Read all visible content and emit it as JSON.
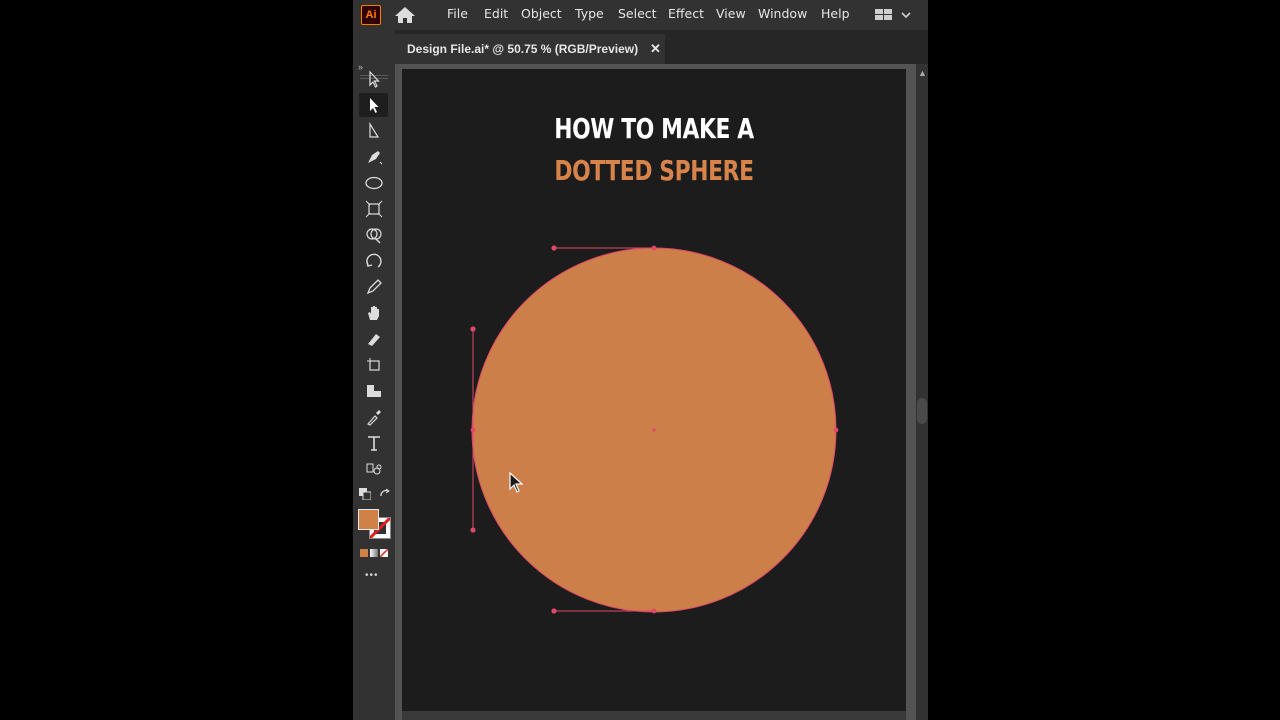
{
  "app": {
    "logo_text": "Ai",
    "menu": [
      "File",
      "Edit",
      "Object",
      "Type",
      "Select",
      "Effect",
      "View",
      "Window",
      "Help"
    ]
  },
  "document": {
    "tab_label": "Design File.ai* @ 50.75 % (RGB/Preview)",
    "close_glyph": "✕"
  },
  "artboard": {
    "title_line1": "HOW TO MAKE A",
    "title_line2": "DOTTED SPHERE"
  },
  "colors": {
    "fill_swatch": "#d08148",
    "circle_fill": "#cc7f48",
    "selection": "#e0486a",
    "accent_title": "#d8834a"
  },
  "toolbar": {
    "tools": [
      "selection-tool",
      "direct-selection-tool",
      "line-tool",
      "pen-tool",
      "ellipse-tool",
      "free-transform-tool",
      "shape-builder-tool",
      "rotate-tool",
      "pencil-tool",
      "hand-tool",
      "eraser-tool",
      "artboard-tool",
      "gradient-tool",
      "eyedropper-tool",
      "type-tool",
      "symbol-sprayer-tool"
    ],
    "active_tool": "direct-selection-tool",
    "more_glyph": "•••"
  }
}
